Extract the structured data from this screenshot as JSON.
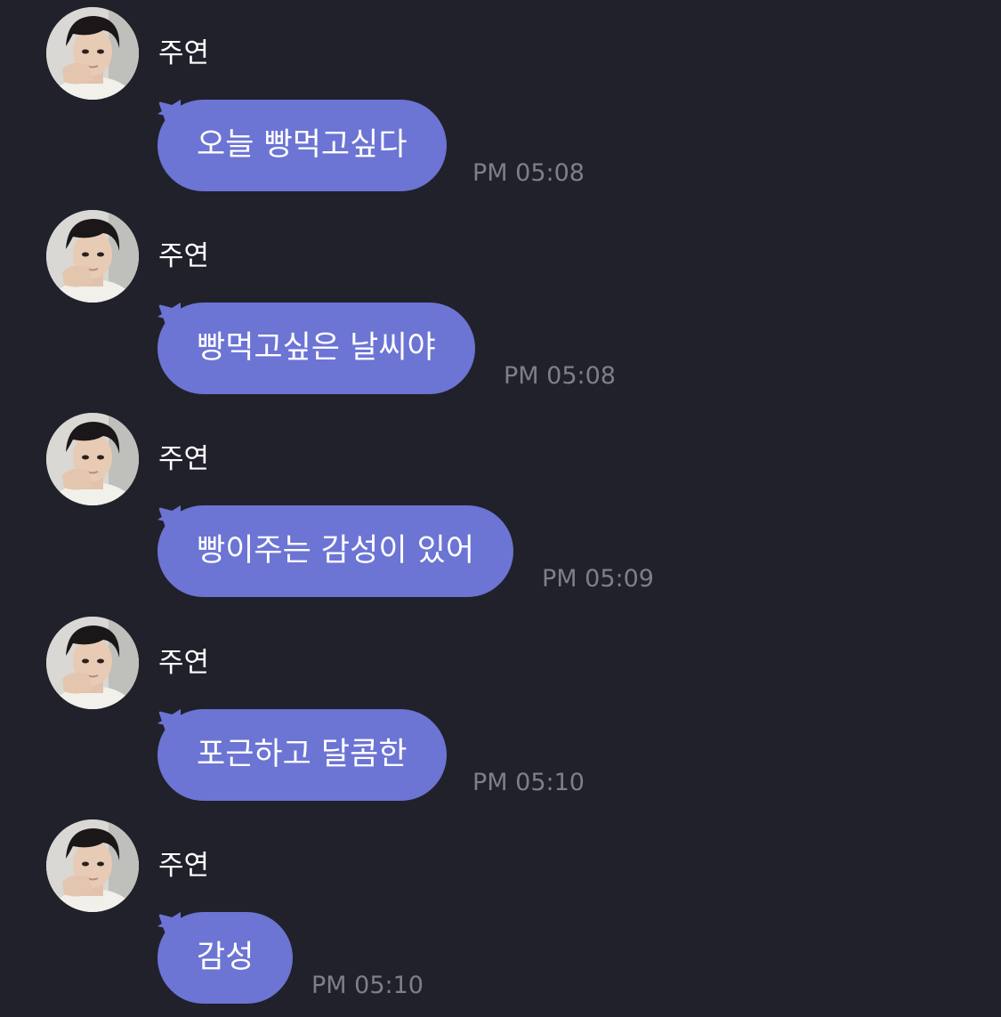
{
  "colors": {
    "background": "#21212b",
    "bubble": "#6c74d4",
    "bubble_text": "#ffffff",
    "sender_text": "#ffffff",
    "time_text": "#7f7f8a"
  },
  "messages": [
    {
      "sender": "주연",
      "text": "오늘 빵먹고싶다",
      "time": "PM 05:08",
      "avatar": "profile-photo-icon"
    },
    {
      "sender": "주연",
      "text": "빵먹고싶은 날씨야",
      "time": "PM 05:08",
      "avatar": "profile-photo-icon"
    },
    {
      "sender": "주연",
      "text": "빵이주는 감성이 있어",
      "time": "PM 05:09",
      "avatar": "profile-photo-icon"
    },
    {
      "sender": "주연",
      "text": "포근하고 달콤한",
      "time": "PM 05:10",
      "avatar": "profile-photo-icon"
    },
    {
      "sender": "주연",
      "text": "감성",
      "time": "PM 05:10",
      "avatar": "profile-photo-icon"
    }
  ]
}
